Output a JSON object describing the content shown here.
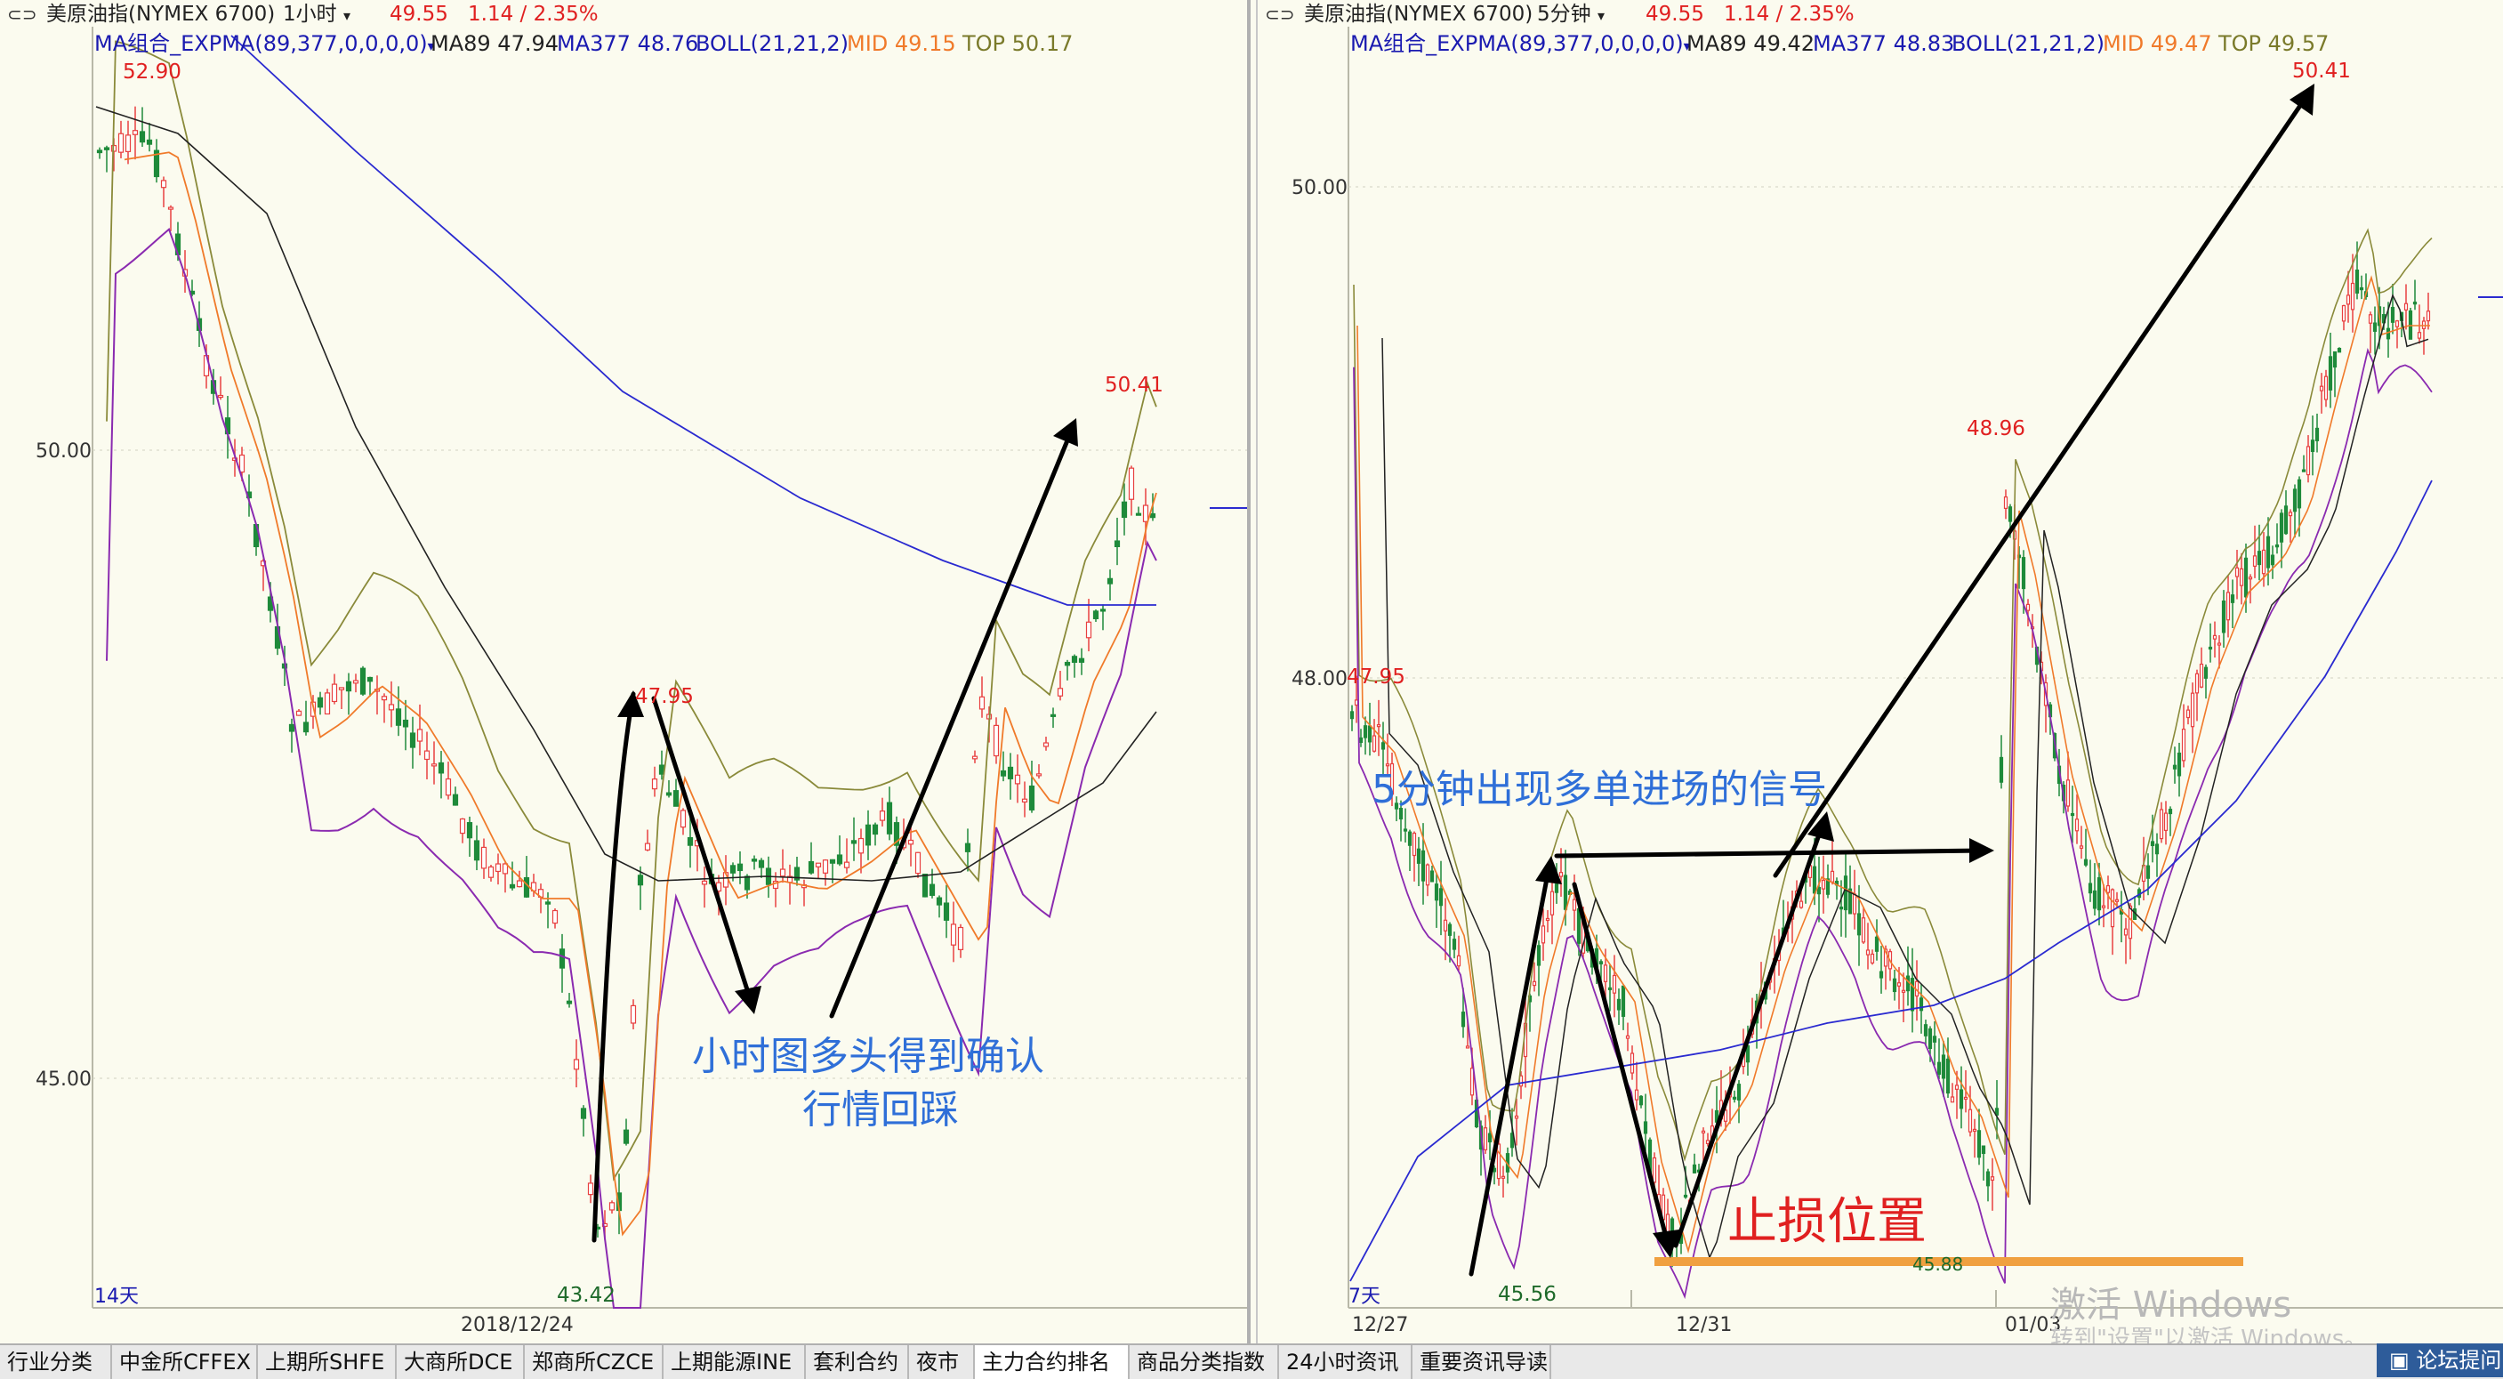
{
  "left_panel": {
    "header": {
      "symbol": "美原油指(NYMEX 6700)",
      "period": "1小时",
      "price": "49.55",
      "change": "1.14 / 2.35%"
    },
    "indicator": {
      "name": "MA组合_EXPMA(89,377,0,0,0,0)",
      "ma89": "MA89 47.94",
      "ma377": "MA377 48.76",
      "boll": "BOLL(21,21,2)",
      "mid": "MID 49.15",
      "top": "TOP 50.17"
    },
    "y_labels": [
      "50.00",
      "45.00"
    ],
    "x_labels": [
      "2018/12/24"
    ],
    "range_label": "14天",
    "price_marks": [
      "52.90",
      "47.95",
      "50.41",
      "43.42"
    ],
    "annotation": [
      "小时图多头得到确认",
      "行情回踩"
    ]
  },
  "right_panel": {
    "header": {
      "symbol": "美原油指(NYMEX 6700)",
      "period": "5分钟",
      "price": "49.55",
      "change": "1.14 / 2.35%"
    },
    "indicator": {
      "name": "MA组合_EXPMA(89,377,0,0,0,0)",
      "ma89": "MA89 49.42",
      "ma377": "MA377 48.83",
      "boll": "BOLL(21,21,2)",
      "mid": "MID 49.47",
      "top": "TOP 49.57"
    },
    "y_labels": [
      "50.00",
      "48.00"
    ],
    "x_labels": [
      "12/27",
      "12/31",
      "01/03"
    ],
    "range_label": "7天",
    "price_marks": [
      "50.41",
      "48.96",
      "47.95",
      "45.56",
      "45.88"
    ],
    "annotation_signal": "5分钟出现多单进场的信号",
    "annotation_stop": "止损位置"
  },
  "watermark": {
    "line1": "激活 Windows",
    "line2": "转到\"设置\"以激活 Windows。"
  },
  "tabs": [
    "行业分类",
    "中金所CFFEX",
    "上期所SHFE",
    "大商所DCE",
    "郑商所CZCE",
    "上期能源INE",
    "套利合约",
    "夜市",
    "主力合约排名",
    "商品分类指数",
    "24小时资讯",
    "重要资讯导读"
  ],
  "active_tab": "主力合约排名",
  "forum_button": "论坛提问",
  "colors": {
    "up": "#E84040",
    "down": "#1E8A3A",
    "ma89": "#222222",
    "ma377": "#2A2AD0",
    "boll_mid": "#F07A2A",
    "boll_top": "#7A7A2A",
    "boll_bottom": "#8A2AB0",
    "annotation_blue": "#2F6FD8",
    "annotation_red": "#E02020",
    "stop_line": "#F0A040"
  }
}
